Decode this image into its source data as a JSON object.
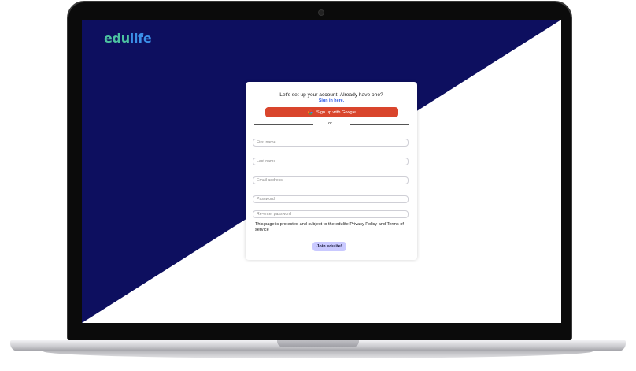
{
  "brand": {
    "logo_part1": "edu",
    "logo_part2": "life"
  },
  "signup": {
    "heading": "Let's set up your account. Already have one?",
    "signin_link": "Sign in here.",
    "google_button": "Sign up with Google",
    "divider_text": "or",
    "fields": {
      "first_name": "First name",
      "last_name": "Last name",
      "email": "Email address",
      "password": "Password",
      "reenter_password": "Re-enter password"
    },
    "notice": "This page is protected and subject to the edulife Privacy Policy and Terms of service",
    "submit": "Join edulife!"
  },
  "colors": {
    "navy": "#0d0f5f",
    "google_red": "#d9452c",
    "submit_bg": "#c9c9ff",
    "link_blue": "#2f5be6"
  }
}
